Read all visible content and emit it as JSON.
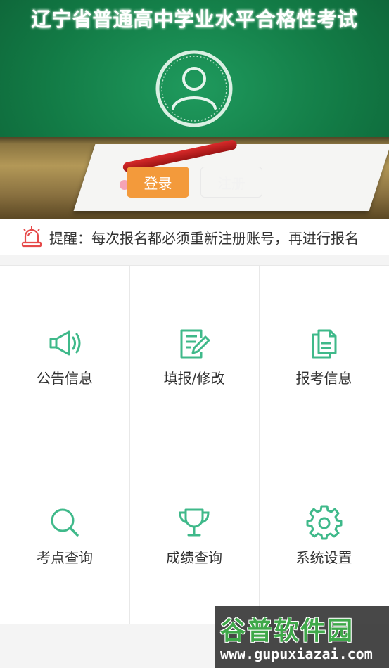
{
  "banner": {
    "title": "辽宁省普通高中学业水平合格性考试",
    "login_label": "登录",
    "register_label": "注册"
  },
  "notice": {
    "text": "提醒：每次报名都必须重新注册账号，再进行报名"
  },
  "menu": [
    {
      "label": "公告信息",
      "icon": "megaphone-icon"
    },
    {
      "label": "填报/修改",
      "icon": "edit-document-icon"
    },
    {
      "label": "报考信息",
      "icon": "documents-icon"
    },
    {
      "label": "考点查询",
      "icon": "search-icon"
    },
    {
      "label": "成绩查询",
      "icon": "trophy-icon"
    },
    {
      "label": "系统设置",
      "icon": "gear-icon"
    }
  ],
  "watermark": {
    "brand": "谷普软件园",
    "url": "www.gupuxiazai.com"
  },
  "colors": {
    "accent_green": "#3fb98a",
    "login_orange": "#f39a3b",
    "notice_red": "#e64a4a"
  }
}
